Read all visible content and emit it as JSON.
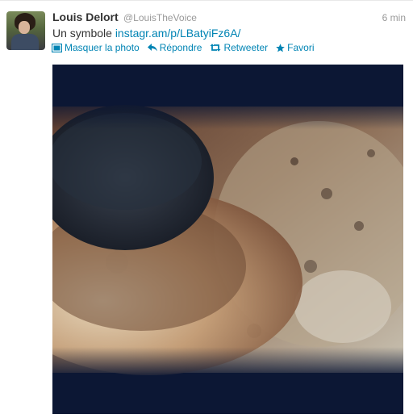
{
  "tweet": {
    "author_name": "Louis Delort",
    "author_handle": "@LouisTheVoice",
    "timestamp": "6 min",
    "text_prefix": "Un symbole ",
    "link_text": "instagr.am/p/LBatyiFz6A/"
  },
  "actions": {
    "hide_photo": "Masquer la photo",
    "reply": "Répondre",
    "retweet": "Retweeter",
    "favorite": "Favori"
  },
  "colors": {
    "link": "#0084b4",
    "muted": "#999999",
    "text": "#333333"
  },
  "icons": {
    "hide_photo": "photo-icon",
    "reply": "reply-arrow-icon",
    "retweet": "retweet-icon",
    "favorite": "star-icon"
  }
}
